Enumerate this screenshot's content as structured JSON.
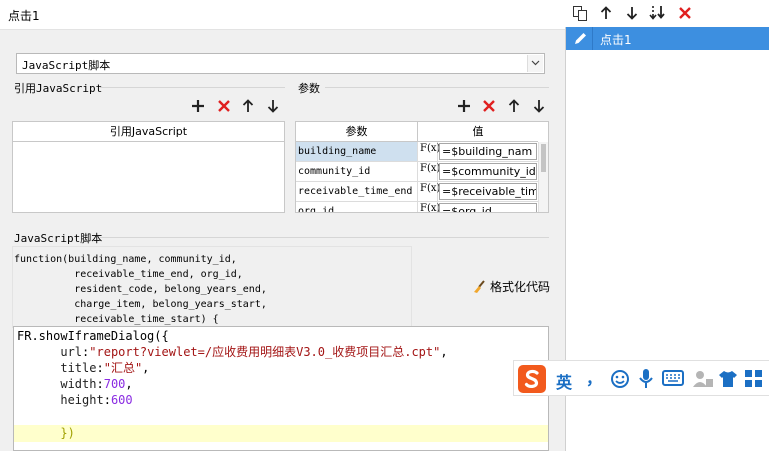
{
  "name_field": {
    "value": "点击1"
  },
  "script_type": {
    "selected": "JavaScript脚本"
  },
  "ref_section": {
    "title": "引用JavaScript",
    "column": "引用JavaScript"
  },
  "params_section": {
    "title": "参数",
    "columns": [
      "参数",
      "值"
    ],
    "rows": [
      {
        "name": "building_name",
        "value": "=$building_nam"
      },
      {
        "name": "community_id",
        "value": "=$community_id"
      },
      {
        "name": "receivable_time_end",
        "value": "=$receivable_tim"
      },
      {
        "name": "org_id",
        "value": "=$org_id"
      }
    ],
    "fx_label": "F(x)"
  },
  "script_section": {
    "title": "JavaScript脚本",
    "func_header": "function(building_name, community_id,\n          receivable_time_end, org_id,\n          resident_code, belong_years_end,\n          charge_item, belong_years_start,\n          receivable_time_start) {",
    "format_label": "格式化代码"
  },
  "editor": {
    "lines": [
      {
        "t": "FR.showIframeDialog({"
      },
      {
        "indent": "      ",
        "key": "url",
        "val": "\"report?viewlet=/应收费用明细表V3.0_收费项目汇总.cpt\"",
        "tail": ","
      },
      {
        "indent": "      ",
        "key": "title",
        "val": "\"汇总\"",
        "tail": ","
      },
      {
        "indent": "      ",
        "key": "width",
        "num": "700",
        "tail": ","
      },
      {
        "indent": "      ",
        "key": "height",
        "num": "600",
        "tail": ""
      },
      {
        "t": ""
      },
      {
        "indent": "      ",
        "close": "})"
      }
    ]
  },
  "events": {
    "items": [
      {
        "label": "点击1"
      }
    ]
  },
  "ime": {
    "lang": "英",
    "punct": "，"
  },
  "colors": {
    "accent": "#3d8fe0",
    "delete": "#e02020",
    "editor_highlight": "#ffffcc"
  }
}
